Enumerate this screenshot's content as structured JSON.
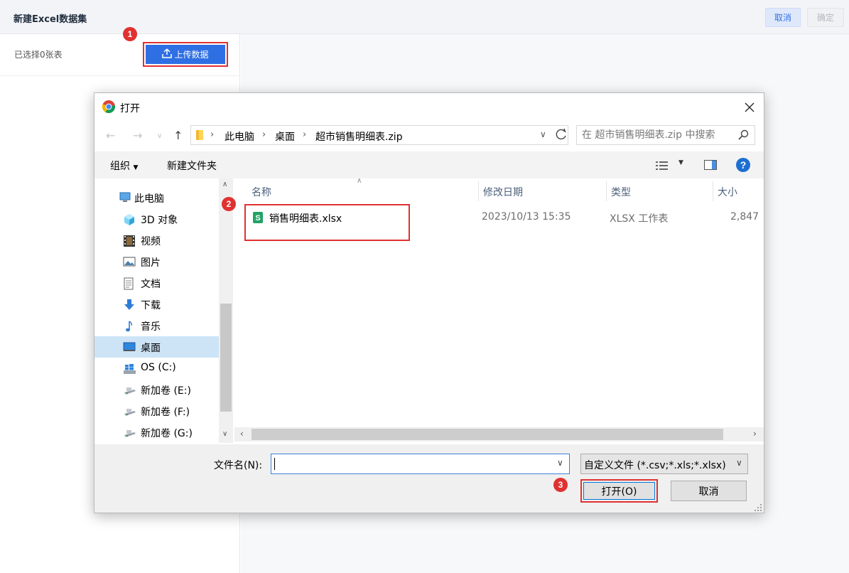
{
  "app": {
    "title": "新建Excel数据集",
    "cancel_label": "取消",
    "confirm_label": "确定",
    "selected_text": "已选择0张表",
    "upload_label": "上传数据"
  },
  "markers": [
    "1",
    "2",
    "3"
  ],
  "dialog": {
    "title": "打开",
    "breadcrumb": [
      "此电脑",
      "桌面",
      "超市销售明细表.zip"
    ],
    "search_placeholder": "在 超市销售明细表.zip 中搜索",
    "toolbar": {
      "organize": "组织",
      "new_folder": "新建文件夹"
    },
    "nav_items": [
      {
        "label": "此电脑",
        "icon": "computer-icon"
      },
      {
        "label": "3D 对象",
        "icon": "cube-icon"
      },
      {
        "label": "视频",
        "icon": "film-icon"
      },
      {
        "label": "图片",
        "icon": "picture-icon"
      },
      {
        "label": "文档",
        "icon": "document-icon"
      },
      {
        "label": "下载",
        "icon": "download-icon"
      },
      {
        "label": "音乐",
        "icon": "music-icon"
      },
      {
        "label": "桌面",
        "icon": "desktop-icon",
        "selected": true
      },
      {
        "label": "OS (C:)",
        "icon": "windows-drive-icon"
      },
      {
        "label": "新加卷 (E:)",
        "icon": "drive-icon"
      },
      {
        "label": "新加卷 (F:)",
        "icon": "drive-icon"
      },
      {
        "label": "新加卷 (G:)",
        "icon": "drive-icon"
      }
    ],
    "columns": [
      "名称",
      "修改日期",
      "类型",
      "大小"
    ],
    "files": [
      {
        "name": "销售明细表.xlsx",
        "modified": "2023/10/13 15:35",
        "type": "XLSX 工作表",
        "size": "2,847"
      }
    ],
    "filename_label": "文件名(N):",
    "filename_value": "",
    "filter": "自定义文件 (*.csv;*.xls;*.xlsx)",
    "open_label": "打开(O)",
    "cancel_label": "取消"
  },
  "colors": {
    "accent": "#2f6fe4",
    "highlight": "#e03131",
    "selected_nav": "#cde4f7"
  }
}
